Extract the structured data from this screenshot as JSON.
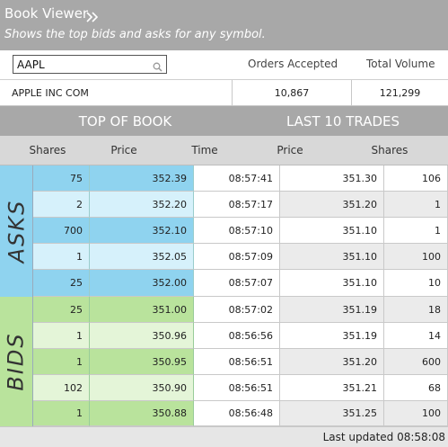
{
  "header": {
    "title": "Book Viewer",
    "subtitle": "Shows the top bids and asks for any symbol.",
    "icon": "double-chevron-right-icon"
  },
  "search": {
    "value": "AAPL",
    "icon": "search-icon"
  },
  "summary": {
    "orders_label": "Orders Accepted",
    "volume_label": "Total Volume",
    "symbol_name": "APPLE INC COM",
    "orders_value": "10,867",
    "volume_value": "121,299"
  },
  "sections": {
    "top_of_book": "TOP OF BOOK",
    "last_trades": "LAST 10 TRADES"
  },
  "columns": {
    "shares": "Shares",
    "price": "Price",
    "time": "Time",
    "trade_price": "Price",
    "trade_shares": "Shares"
  },
  "side_labels": {
    "asks": "ASKS",
    "bids": "BIDS"
  },
  "asks": [
    {
      "shares": "75",
      "price": "352.39"
    },
    {
      "shares": "2",
      "price": "352.20"
    },
    {
      "shares": "700",
      "price": "352.10"
    },
    {
      "shares": "1",
      "price": "352.05"
    },
    {
      "shares": "25",
      "price": "352.00"
    }
  ],
  "bids": [
    {
      "shares": "25",
      "price": "351.00"
    },
    {
      "shares": "1",
      "price": "350.96"
    },
    {
      "shares": "1",
      "price": "350.95"
    },
    {
      "shares": "102",
      "price": "350.90"
    },
    {
      "shares": "1",
      "price": "350.88"
    }
  ],
  "trades": [
    {
      "time": "08:57:41",
      "price": "351.30",
      "shares": "106"
    },
    {
      "time": "08:57:17",
      "price": "351.20",
      "shares": "1"
    },
    {
      "time": "08:57:10",
      "price": "351.10",
      "shares": "1"
    },
    {
      "time": "08:57:09",
      "price": "351.10",
      "shares": "100"
    },
    {
      "time": "08:57:07",
      "price": "351.10",
      "shares": "10"
    },
    {
      "time": "08:57:02",
      "price": "351.19",
      "shares": "18"
    },
    {
      "time": "08:56:56",
      "price": "351.19",
      "shares": "14"
    },
    {
      "time": "08:56:51",
      "price": "351.20",
      "shares": "600"
    },
    {
      "time": "08:56:51",
      "price": "351.21",
      "shares": "68"
    },
    {
      "time": "08:56:48",
      "price": "351.25",
      "shares": "100"
    }
  ],
  "footer": {
    "last_updated": "Last updated 08:58:08"
  },
  "colors": {
    "ask_dark": "#8fd3ef",
    "ask_light": "#d6f1fb",
    "bid_dark": "#b9e39c",
    "bid_light": "#e4f5d8",
    "header_gray": "#a8a8a8",
    "trade_row_alt": "#ebebeb"
  }
}
